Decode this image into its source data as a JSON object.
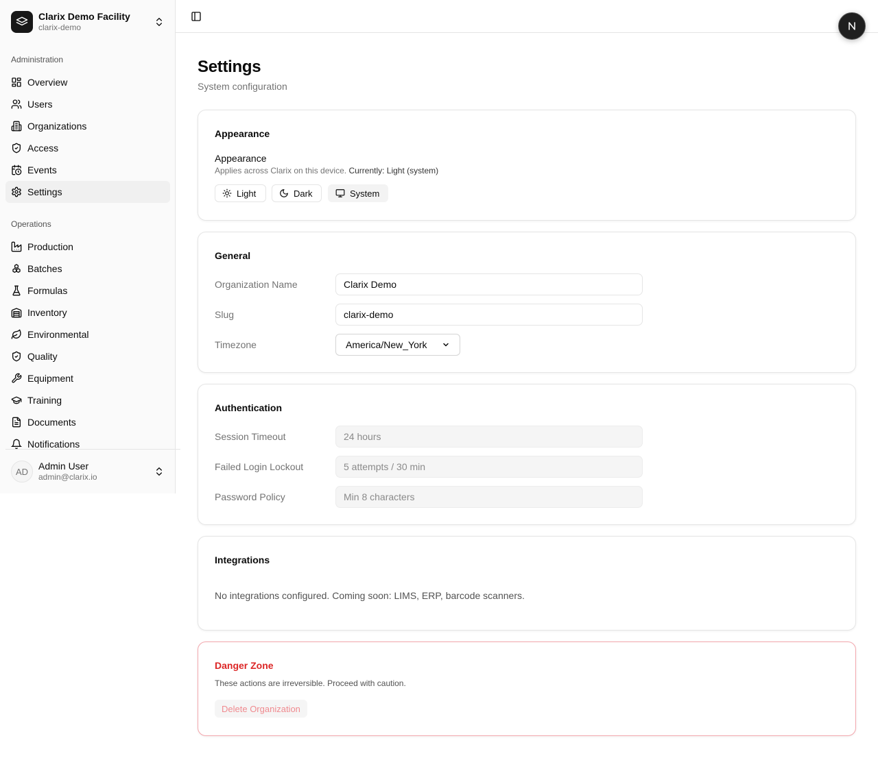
{
  "org": {
    "name": "Clarix Demo Facility",
    "slug": "clarix-demo"
  },
  "sidebar": {
    "administration_label": "Administration",
    "administration": [
      {
        "label": "Overview",
        "icon": "grid-icon"
      },
      {
        "label": "Users",
        "icon": "users-icon"
      },
      {
        "label": "Organizations",
        "icon": "building-icon"
      },
      {
        "label": "Access",
        "icon": "shield-icon"
      },
      {
        "label": "Events",
        "icon": "calendar-clock-icon"
      },
      {
        "label": "Settings",
        "icon": "gear-icon",
        "active": true
      }
    ],
    "operations_label": "Operations",
    "operations": [
      {
        "label": "Production",
        "icon": "factory-icon"
      },
      {
        "label": "Batches",
        "icon": "boxes-icon"
      },
      {
        "label": "Formulas",
        "icon": "flask-icon"
      },
      {
        "label": "Inventory",
        "icon": "warehouse-icon"
      },
      {
        "label": "Environmental",
        "icon": "leaf-icon"
      },
      {
        "label": "Quality",
        "icon": "shield-check-icon"
      },
      {
        "label": "Equipment",
        "icon": "wrench-icon"
      },
      {
        "label": "Training",
        "icon": "graduation-cap-icon"
      },
      {
        "label": "Documents",
        "icon": "file-text-icon"
      },
      {
        "label": "Notifications",
        "icon": "bell-icon"
      }
    ]
  },
  "user": {
    "initials": "AD",
    "name": "Admin User",
    "email": "admin@clarix.io"
  },
  "header": {
    "badge_letter": "N"
  },
  "page": {
    "title": "Settings",
    "subtitle": "System configuration"
  },
  "appearance": {
    "card_title": "Appearance",
    "section_title": "Appearance",
    "description": "Applies across Clarix on this device.",
    "current": "Currently: Light (system)",
    "options": [
      "Light",
      "Dark",
      "System"
    ],
    "selected": "System"
  },
  "general": {
    "card_title": "General",
    "org_name_label": "Organization Name",
    "org_name_value": "Clarix Demo",
    "slug_label": "Slug",
    "slug_value": "clarix-demo",
    "timezone_label": "Timezone",
    "timezone_value": "America/New_York"
  },
  "auth": {
    "card_title": "Authentication",
    "session_label": "Session Timeout",
    "session_value": "24 hours",
    "lockout_label": "Failed Login Lockout",
    "lockout_value": "5 attempts / 30 min",
    "password_label": "Password Policy",
    "password_value": "Min 8 characters"
  },
  "integrations": {
    "card_title": "Integrations",
    "message": "No integrations configured. Coming soon: LIMS, ERP, barcode scanners."
  },
  "danger": {
    "card_title": "Danger Zone",
    "description": "These actions are irreversible. Proceed with caution.",
    "delete_label": "Delete Organization"
  },
  "colors": {
    "danger": "#dc2626",
    "danger_border": "#f3a6ac",
    "muted": "#737373"
  }
}
